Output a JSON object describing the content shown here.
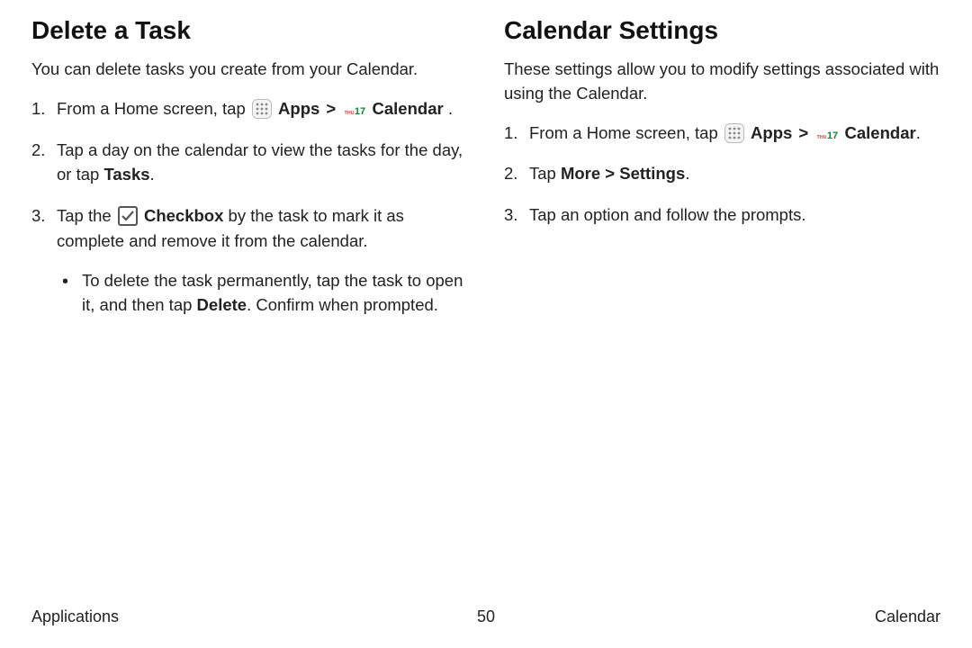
{
  "left": {
    "heading": "Delete a Task",
    "intro": "You can delete tasks you create from your Calendar.",
    "step1_pre": "From a Home screen, tap ",
    "apps_label": "Apps",
    "cal_label": " Calendar ",
    "step1_post": ".",
    "step2_pre": "Tap a day on the calendar to view the tasks for the day, or tap ",
    "step2_bold": "Tasks",
    "step2_post": ".",
    "step3_pre": "Tap the ",
    "step3_bold": "Checkbox",
    "step3_post": " by the task to mark it as complete and remove it from the calendar.",
    "sub_pre": "To delete the task permanently, tap the task to open it, and then tap ",
    "sub_bold": "Delete",
    "sub_post": ". Confirm when prompted."
  },
  "right": {
    "heading": "Calendar Settings",
    "intro": "These settings allow you to modify settings associated with using the Calendar.",
    "step1_pre": "From a Home screen, tap ",
    "apps_label": "Apps",
    "cal_label": " Calendar",
    "step1_post": ".",
    "step2_pre": "Tap ",
    "step2_more": "More",
    "step2_chev": " > ",
    "step2_settings": "Settings",
    "step2_post": ".",
    "step3": "Tap an option and follow the prompts."
  },
  "icons": {
    "cal_dow": "THU",
    "cal_num": "17"
  },
  "chevron": ">",
  "footer": {
    "left": "Applications",
    "center": "50",
    "right": "Calendar"
  }
}
